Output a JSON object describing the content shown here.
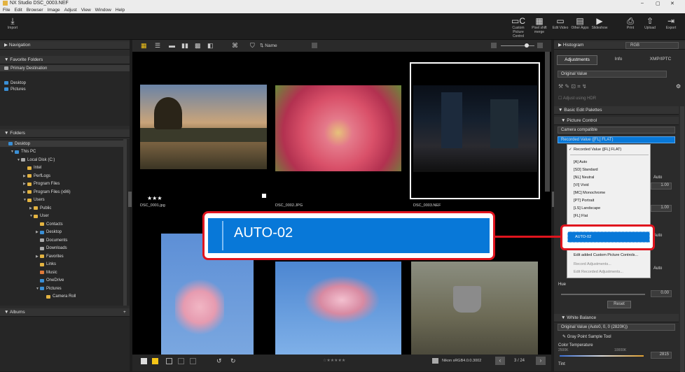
{
  "app": {
    "title": "NX Studio   DSC_0003.NEF",
    "win_min": "–",
    "win_max": "▢",
    "win_close": "✕"
  },
  "menu": [
    "File",
    "Edit",
    "Browser",
    "Image",
    "Adjust",
    "View",
    "Window",
    "Help"
  ],
  "toolbar": {
    "import": "Import",
    "right": [
      {
        "label": "Custom Picture Control",
        "icon": "▭C"
      },
      {
        "label": "Pixel shift merge",
        "icon": "▦"
      },
      {
        "label": "Edit Video",
        "icon": "▭"
      },
      {
        "label": "Other Apps",
        "icon": "▤"
      },
      {
        "label": "Slideshow",
        "icon": "▶"
      },
      {
        "label": "Print",
        "icon": "⎙"
      },
      {
        "label": "Upload",
        "icon": "⇧"
      },
      {
        "label": "Export",
        "icon": "⇥"
      }
    ]
  },
  "left": {
    "navigation": "Navigation",
    "favorites": "Favorite Folders",
    "primary": "Primary Destination",
    "fav_items": [
      "Desktop",
      "Pictures"
    ],
    "folders": "Folders",
    "tree": [
      {
        "t": "Desktop",
        "i": 0,
        "c": "blue"
      },
      {
        "t": "This PC",
        "i": 1,
        "c": "blue",
        "o": "▼"
      },
      {
        "t": "Local Disk (C:)",
        "i": 2,
        "c": "grey",
        "o": "▼"
      },
      {
        "t": "Intel",
        "i": 3
      },
      {
        "t": "PerfLogs",
        "i": 3,
        "o": "▶"
      },
      {
        "t": "Program Files",
        "i": 3,
        "o": "▶"
      },
      {
        "t": "Program Files (x86)",
        "i": 3,
        "o": "▶"
      },
      {
        "t": "Users",
        "i": 3,
        "o": "▼"
      },
      {
        "t": "Public",
        "i": 4,
        "o": "▶"
      },
      {
        "t": "User",
        "i": 4,
        "o": "▼"
      },
      {
        "t": "Contacts",
        "i": 5
      },
      {
        "t": "Desktop",
        "i": 5,
        "c": "blue",
        "o": "▶"
      },
      {
        "t": "Documents",
        "i": 5,
        "c": "grey"
      },
      {
        "t": "Downloads",
        "i": 5,
        "c": "grey"
      },
      {
        "t": "Favorites",
        "i": 5,
        "o": "▶"
      },
      {
        "t": "Links",
        "i": 5
      },
      {
        "t": "Music",
        "i": 5,
        "c": "orange"
      },
      {
        "t": "OneDrive",
        "i": 5,
        "c": "blue"
      },
      {
        "t": "Pictures",
        "i": 5,
        "c": "blue",
        "o": "▼"
      },
      {
        "t": "Camera Roll",
        "i": 6
      }
    ],
    "albums": "Albums",
    "albums_add": "+"
  },
  "center": {
    "sort": "Name",
    "files": [
      "DSC_0001.jpg",
      "DSC_0002.JPG",
      "DSC_0003.NEF"
    ],
    "stars": "★★★",
    "rating_bar": "☆★★★★★",
    "profile": "Nikon sRGB4.0.0.3002",
    "page": "3 / 24"
  },
  "right": {
    "histogram": "Histogram",
    "hist_mode": "RGB",
    "tabs": [
      "Adjustments",
      "Info",
      "XMP/IPTC"
    ],
    "original": "Original Value",
    "adjust_hdr": "Adjust using HDR",
    "basic": "Basic Edit Palettes",
    "pc": "Picture Control",
    "pc_dd": "Camera compatible",
    "pc_sel": "Recorded Value ([FL] FLAT)",
    "hue": "Hue",
    "hue_val": "0.00",
    "reset": "Reset",
    "wb": "White Balance",
    "wb_dd": "Original Value (Auto0, 0, 0 (2820K))",
    "gray": "Gray Point Sample Tool",
    "ct": "Color Temperature",
    "ct_min": "2500K",
    "ct_max": "10000K",
    "ct_val": "2815",
    "tint": "Tint",
    "auto": "Auto",
    "val1": "1.00"
  },
  "menu_popup": {
    "items": [
      "Recorded Value ([FL] FLAT)",
      "[A] Auto",
      "[SD] Standard",
      "[NL] Neutral",
      "[VI] Vivid",
      "[MC] Monochrome",
      "[PT] Portrait",
      "[LS] Landscape",
      "[FL] Flat"
    ],
    "selected": "AUTO-02",
    "extra": [
      "Edit added Custom Picture Controls...",
      "Record Adjustments...",
      "Edit Recorded Adjustments..."
    ],
    "check": "✓"
  },
  "callout": {
    "text": "AUTO-02"
  },
  "colors": {
    "accent": "#0878d8",
    "callout": "#e0141e",
    "folder": "#e3b341"
  }
}
